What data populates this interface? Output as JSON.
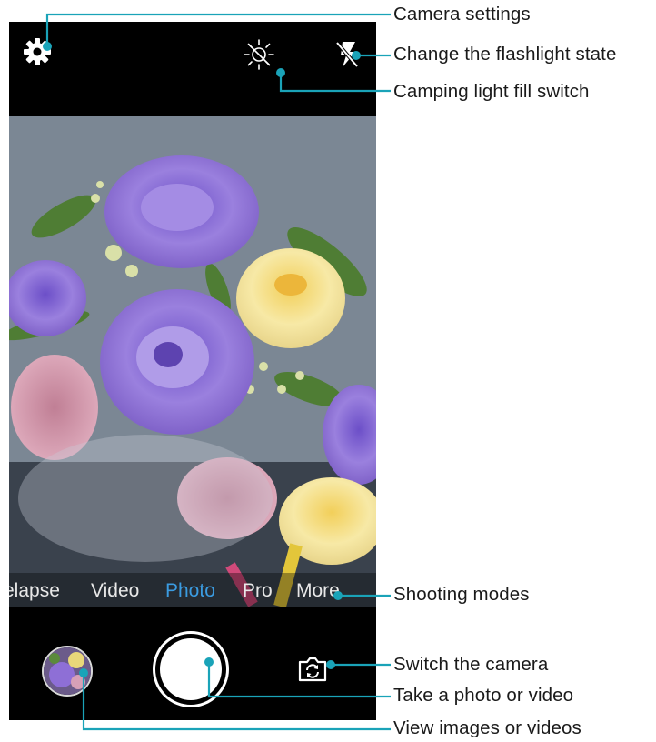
{
  "callouts": {
    "camera_settings": "Camera settings",
    "flashlight_state": "Change the flashlight state",
    "camping_light": "Camping light fill switch",
    "shooting_modes": "Shooting modes",
    "switch_camera": "Switch the camera",
    "take_photo": "Take a photo or video",
    "view_images": "View images or videos"
  },
  "camera": {
    "modes": [
      "elapse",
      "Video",
      "Photo",
      "Pro",
      "More"
    ],
    "active_mode": "Photo"
  },
  "icons": {
    "settings": "gear-icon",
    "camping_light": "light-off-icon",
    "flash": "flash-off-icon",
    "switch_camera": "switch-camera-icon"
  },
  "colors": {
    "callout_line": "#1aa3b8",
    "active_mode": "#3b9be0",
    "screen_bg": "#000000"
  }
}
